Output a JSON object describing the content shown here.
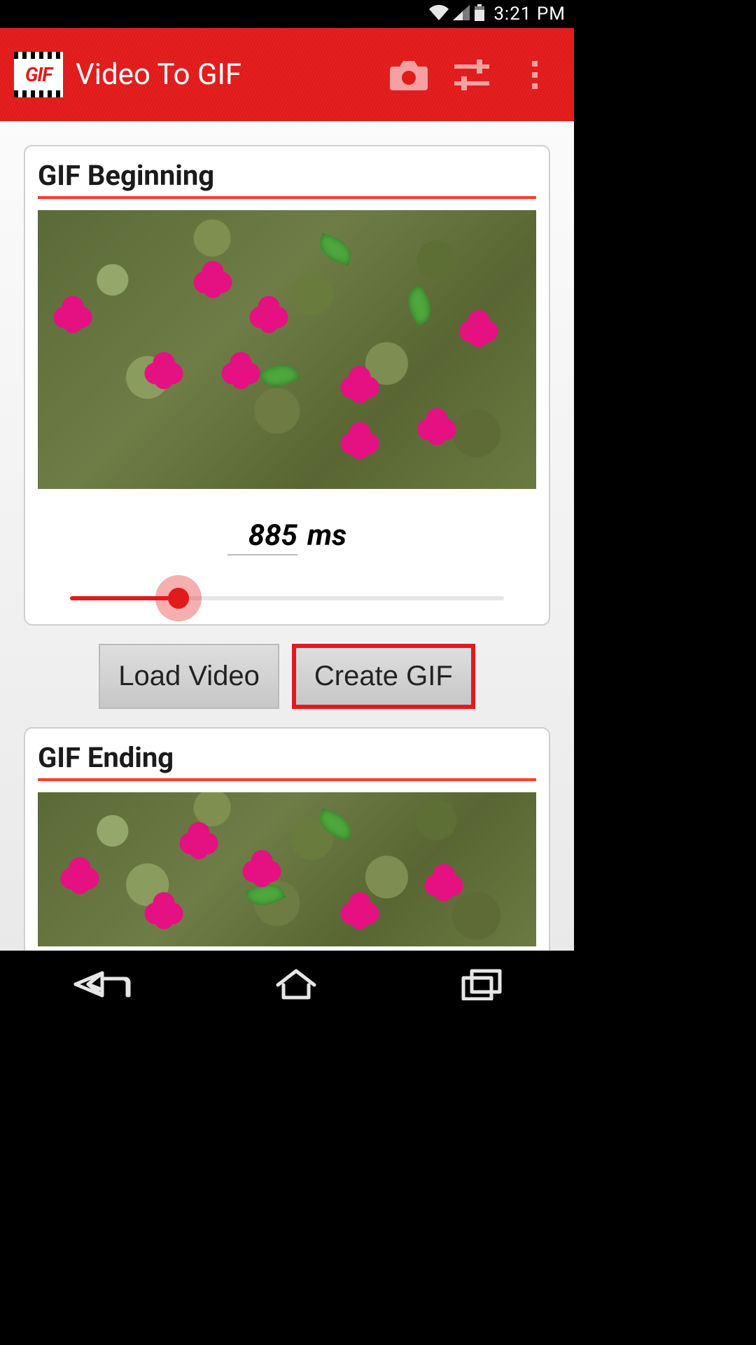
{
  "status": {
    "time": "3:21 PM"
  },
  "titlebar": {
    "logo_text": "GIF",
    "title": "Video To GIF"
  },
  "sections": {
    "begin_title": "GIF Beginning",
    "end_title": "GIF Ending"
  },
  "time_display": {
    "value": "885",
    "unit": "ms"
  },
  "slider": {
    "percent": 25
  },
  "buttons": {
    "load": "Load Video",
    "create": "Create GIF"
  }
}
